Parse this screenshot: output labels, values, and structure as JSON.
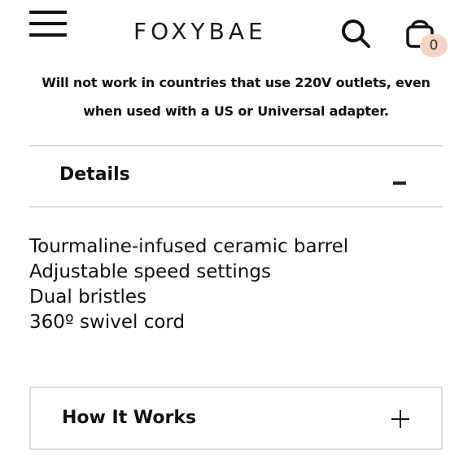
{
  "header": {
    "menu_icon": "hamburger-menu-icon",
    "logo_text": "FOXYBAE",
    "search_icon": "search-icon",
    "cart_icon": "shopping-bag-icon",
    "cart_count": "0",
    "badge_color": "#f7d4c3"
  },
  "notice": {
    "line1": "Will not work in countries that use 220V outlets, even",
    "line2": "when used with a US or Universal adapter."
  },
  "details": {
    "title": "Details",
    "toggle_icon": "minus-icon",
    "expanded": true,
    "items": [
      "Tourmaline-infused ceramic barrel",
      "Adjustable speed settings",
      "Dual bristles",
      "360º swivel cord"
    ]
  },
  "how_it_works": {
    "title": "How It Works",
    "toggle_icon": "plus-icon",
    "expanded": false
  },
  "colors": {
    "divider": "#dcdcdc",
    "text": "#111111"
  }
}
